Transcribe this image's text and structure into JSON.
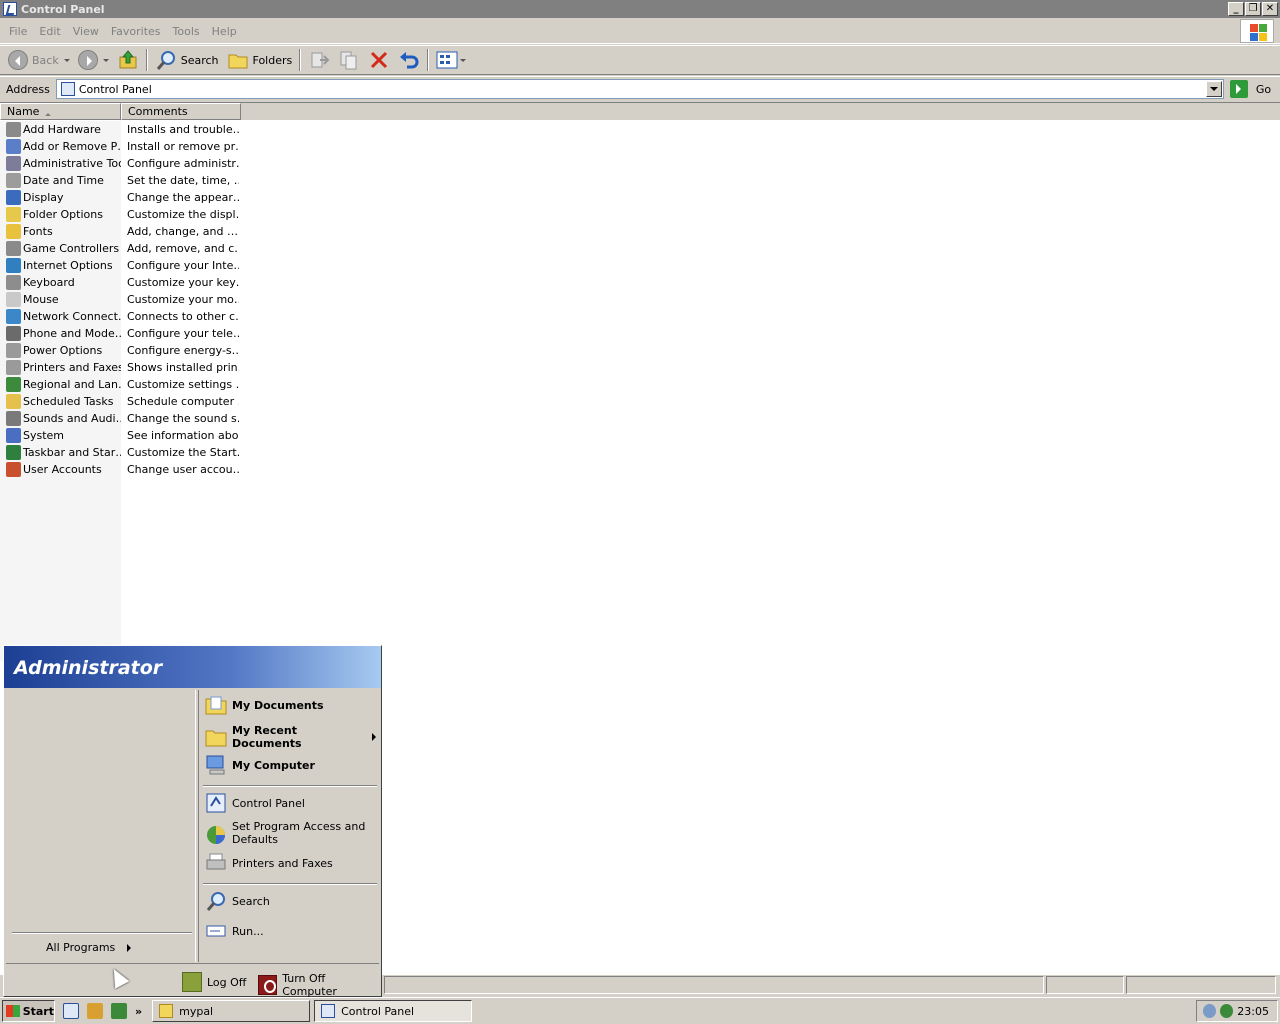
{
  "window": {
    "title": "Control Panel"
  },
  "menubar": [
    "File",
    "Edit",
    "View",
    "Favorites",
    "Tools",
    "Help"
  ],
  "toolbar": {
    "back": "Back",
    "search": "Search",
    "folders": "Folders"
  },
  "address": {
    "label": "Address",
    "value": "Control Panel",
    "go": "Go"
  },
  "columns": {
    "name": "Name",
    "comments": "Comments"
  },
  "items": [
    {
      "name": "Add Hardware",
      "comment": "Installs and trouble…",
      "color": "#8a8a8a"
    },
    {
      "name": "Add or Remove P…",
      "comment": "Install or remove pr…",
      "color": "#5a7fc8"
    },
    {
      "name": "Administrative Tools",
      "comment": "Configure administr…",
      "color": "#7d7d9a"
    },
    {
      "name": "Date and Time",
      "comment": "Set the date, time, …",
      "color": "#9c9c9c"
    },
    {
      "name": "Display",
      "comment": "Change the appear…",
      "color": "#3a6bbd"
    },
    {
      "name": "Folder Options",
      "comment": "Customize the displ…",
      "color": "#e6c84a"
    },
    {
      "name": "Fonts",
      "comment": "Add, change, and …",
      "color": "#e8c23c"
    },
    {
      "name": "Game Controllers",
      "comment": "Add, remove, and c…",
      "color": "#8a8a8a"
    },
    {
      "name": "Internet Options",
      "comment": "Configure your Inte…",
      "color": "#2f7fc1"
    },
    {
      "name": "Keyboard",
      "comment": "Customize your key…",
      "color": "#8d8d8d"
    },
    {
      "name": "Mouse",
      "comment": "Customize your mo…",
      "color": "#c9c9c9"
    },
    {
      "name": "Network Connect…",
      "comment": "Connects to other c…",
      "color": "#3b88c9"
    },
    {
      "name": "Phone and Mode…",
      "comment": "Configure your tele…",
      "color": "#6b6b6b"
    },
    {
      "name": "Power Options",
      "comment": "Configure energy-s…",
      "color": "#9a9a9a"
    },
    {
      "name": "Printers and Faxes",
      "comment": "Shows installed prin…",
      "color": "#9a9a9a"
    },
    {
      "name": "Regional and Lan…",
      "comment": "Customize settings …",
      "color": "#3c8a3c"
    },
    {
      "name": "Scheduled Tasks",
      "comment": "Schedule computer …",
      "color": "#e5c04a"
    },
    {
      "name": "Sounds and Audi…",
      "comment": "Change the sound s…",
      "color": "#7a7a7a"
    },
    {
      "name": "System",
      "comment": "See information abo…",
      "color": "#4a6fc2"
    },
    {
      "name": "Taskbar and Star…",
      "comment": "Customize the Start…",
      "color": "#2f7f3f"
    },
    {
      "name": "User Accounts",
      "comment": "Change user accou…",
      "color": "#c8502e"
    }
  ],
  "startmenu": {
    "user": "Administrator",
    "all_programs": "All Programs",
    "right": {
      "my_documents": "My Documents",
      "my_recent_documents": "My Recent Documents",
      "my_computer": "My Computer",
      "control_panel": "Control Panel",
      "set_program_access": "Set Program Access and Defaults",
      "printers_faxes": "Printers and Faxes",
      "search": "Search",
      "run": "Run..."
    },
    "log_off": "Log Off",
    "turn_off": "Turn Off Computer"
  },
  "taskbar": {
    "start": "Start",
    "overflow": "»",
    "tasks": [
      "mypal",
      "Control Panel"
    ],
    "clock": "23:05"
  }
}
